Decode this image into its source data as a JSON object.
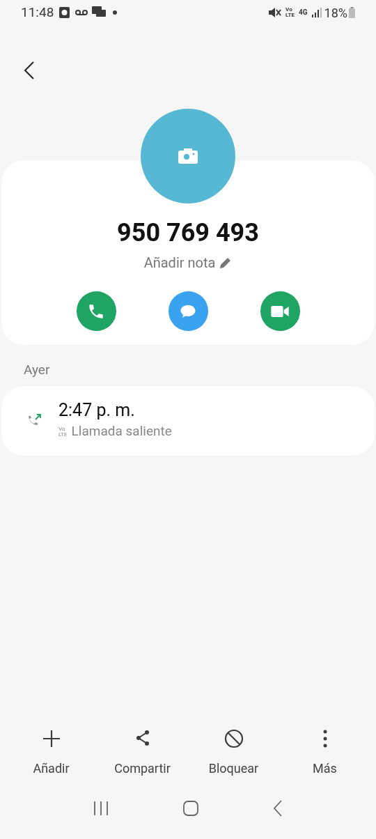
{
  "status_bar": {
    "time": "11:48",
    "volte": [
      "Vo",
      "LTE"
    ],
    "network": "4G",
    "battery": "18%"
  },
  "contact": {
    "number": "950 769 493",
    "note": "Añadir nota"
  },
  "quick_actions": [
    {
      "kind": "call",
      "color": "#1fa463"
    },
    {
      "kind": "message",
      "color": "#3aa3f0"
    },
    {
      "kind": "video",
      "color": "#1fa463"
    }
  ],
  "history": {
    "day": "Ayer",
    "calls": [
      {
        "time": "2:47 p. m.",
        "volte": [
          "Vo",
          "LTE"
        ],
        "type": "Llamada saliente"
      }
    ]
  },
  "bottom_actions": [
    {
      "kind": "add",
      "label": "Añadir"
    },
    {
      "kind": "share",
      "label": "Compartir"
    },
    {
      "kind": "block",
      "label": "Bloquear"
    },
    {
      "kind": "more",
      "label": "Más"
    }
  ]
}
